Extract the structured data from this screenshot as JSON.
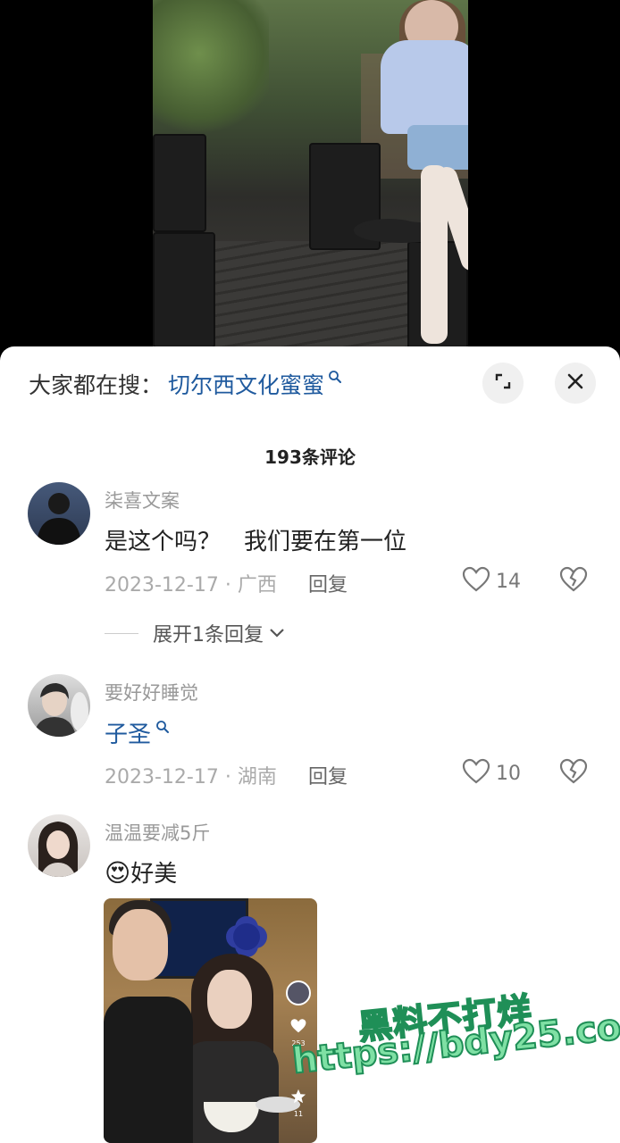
{
  "search": {
    "prefix": "大家都在搜：",
    "term": "切尔西文化蜜蜜"
  },
  "comment_count": "193条评论",
  "comments": [
    {
      "name": "柒喜文案",
      "text": "是这个吗？　我们要在第一位",
      "meta": "2023-12-17 · 广西",
      "reply_label": "回复",
      "likes": "14",
      "expand_label": "展开1条回复"
    },
    {
      "name": "要好好睡觉",
      "text": "子圣",
      "meta": "2023-12-17 · 湖南",
      "reply_label": "回复",
      "likes": "10"
    },
    {
      "name": "温温要减5斤",
      "text": "好美",
      "emoji": "😍"
    }
  ],
  "image_overlay": {
    "like_count": "253",
    "star_count": "11"
  },
  "watermark": {
    "line1": "黑料不打烊",
    "line2": "https://bdy25.co"
  },
  "colors": {
    "link": "#1f5a9e",
    "watermark_fill": "#7fe0a4",
    "watermark_stroke": "#1f8f57"
  }
}
